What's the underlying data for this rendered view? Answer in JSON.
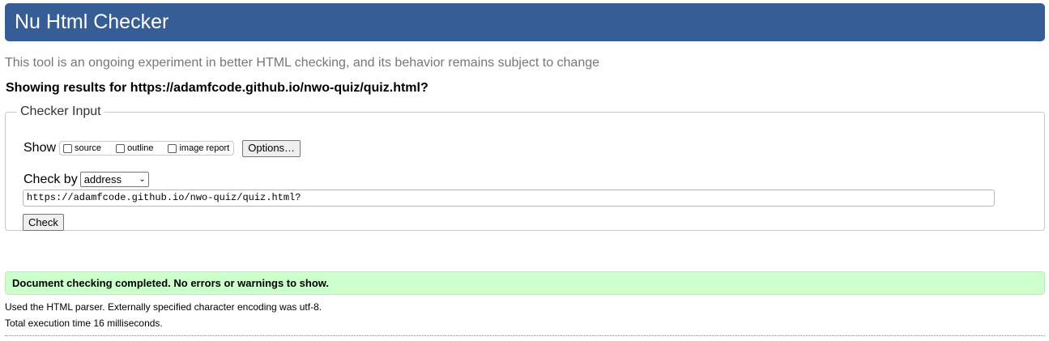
{
  "header": {
    "title": "Nu Html Checker",
    "background_color": "#365d95"
  },
  "tagline": "This tool is an ongoing experiment in better HTML checking, and its behavior remains subject to change",
  "results_for": "Showing results for https://adamfcode.github.io/nwo-quiz/quiz.html?",
  "checker_input": {
    "legend": "Checker Input",
    "show_label": "Show",
    "show_options": [
      {
        "label": "source",
        "checked": false
      },
      {
        "label": "outline",
        "checked": false
      },
      {
        "label": "image report",
        "checked": false
      }
    ],
    "options_button": "Options…",
    "check_by_label": "Check by",
    "check_by_selected": "address",
    "url_value": "https://adamfcode.github.io/nwo-quiz/quiz.html?",
    "check_button": "Check"
  },
  "result": {
    "message": "Document checking completed. No errors or warnings to show.",
    "background_color": "#ccffcc"
  },
  "info": {
    "parser_line": "Used the HTML parser. Externally specified character encoding was utf-8.",
    "execution_line": "Total execution time 16 milliseconds."
  }
}
